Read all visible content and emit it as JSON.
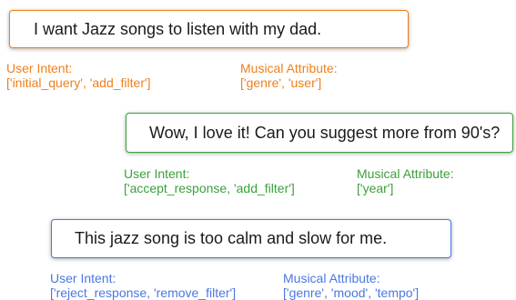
{
  "turns": [
    {
      "utterance": "I want Jazz songs to listen with my dad.",
      "intent_label": "User Intent:",
      "intent_value": "['initial_query', 'add_filter']",
      "attr_label": "Musical Attribute:",
      "attr_value": "['genre', 'user']",
      "color": "#f07f1a"
    },
    {
      "utterance": "Wow, I love it! Can you suggest more from 90's?",
      "intent_label": "User Intent:",
      "intent_value": "['accept_response, 'add_filter']",
      "attr_label": "Musical Attribute:",
      "attr_value": "['year']",
      "color": "#3aa13a"
    },
    {
      "utterance": "This jazz song is too calm and slow for me.",
      "intent_label": "User Intent:",
      "intent_value": "['reject_response, 'remove_filter']",
      "attr_label": "Musical Attribute:",
      "attr_value": "['genre', 'mood', 'tempo']",
      "color": "#4a78e0"
    }
  ]
}
